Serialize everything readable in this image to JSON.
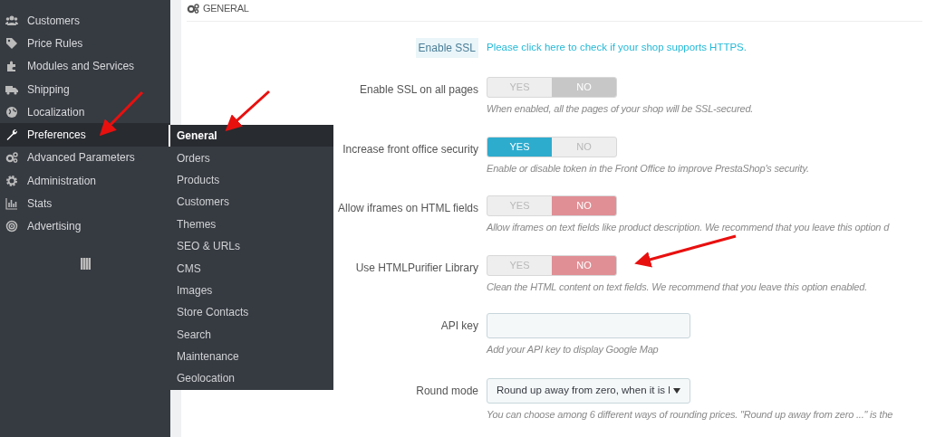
{
  "sidebar": {
    "items": [
      {
        "label": "Customers",
        "selected": false
      },
      {
        "label": "Price Rules",
        "selected": false
      },
      {
        "label": "Modules and Services",
        "selected": false
      },
      {
        "label": "Shipping",
        "selected": false
      },
      {
        "label": "Localization",
        "selected": false
      },
      {
        "label": "Preferences",
        "selected": true
      },
      {
        "label": "Advanced Parameters",
        "selected": false
      },
      {
        "label": "Administration",
        "selected": false
      },
      {
        "label": "Stats",
        "selected": false
      },
      {
        "label": "Advertising",
        "selected": false
      }
    ]
  },
  "submenu": {
    "items": [
      {
        "label": "General",
        "selected": true
      },
      {
        "label": "Orders",
        "selected": false
      },
      {
        "label": "Products",
        "selected": false
      },
      {
        "label": "Customers",
        "selected": false
      },
      {
        "label": "Themes",
        "selected": false
      },
      {
        "label": "SEO & URLs",
        "selected": false
      },
      {
        "label": "CMS",
        "selected": false
      },
      {
        "label": "Images",
        "selected": false
      },
      {
        "label": "Store Contacts",
        "selected": false
      },
      {
        "label": "Search",
        "selected": false
      },
      {
        "label": "Maintenance",
        "selected": false
      },
      {
        "label": "Geolocation",
        "selected": false
      }
    ]
  },
  "panel": {
    "title": "GENERAL",
    "fields": [
      {
        "kind": "link",
        "label": "Enable SSL",
        "link": "Please click here to check if your shop supports HTTPS."
      },
      {
        "kind": "toggle",
        "label": "Enable SSL on all pages",
        "yes": "YES",
        "no": "NO",
        "on": false,
        "disabled": true,
        "help": "When enabled, all the pages of your shop will be SSL-secured."
      },
      {
        "kind": "toggle",
        "label": "Increase front office security",
        "yes": "YES",
        "no": "NO",
        "on": true,
        "disabled": false,
        "help": "Enable or disable token in the Front Office to improve PrestaShop's security."
      },
      {
        "kind": "toggle",
        "label": "Allow iframes on HTML fields",
        "yes": "YES",
        "no": "NO",
        "on": false,
        "disabled": false,
        "help": "Allow iframes on text fields like product description. We recommend that you leave this option d"
      },
      {
        "kind": "toggle",
        "label": "Use HTMLPurifier Library",
        "yes": "YES",
        "no": "NO",
        "on": false,
        "disabled": false,
        "help": "Clean the HTML content on text fields. We recommend that you leave this option enabled."
      },
      {
        "kind": "text",
        "label": "API key",
        "help": "Add your API key to display Google Map"
      },
      {
        "kind": "select",
        "label": "Round mode",
        "value": "Round up away from zero, when it is l",
        "help": "You can choose among 6 different ways of rounding prices. \"Round up away from zero ...\" is the"
      }
    ]
  }
}
